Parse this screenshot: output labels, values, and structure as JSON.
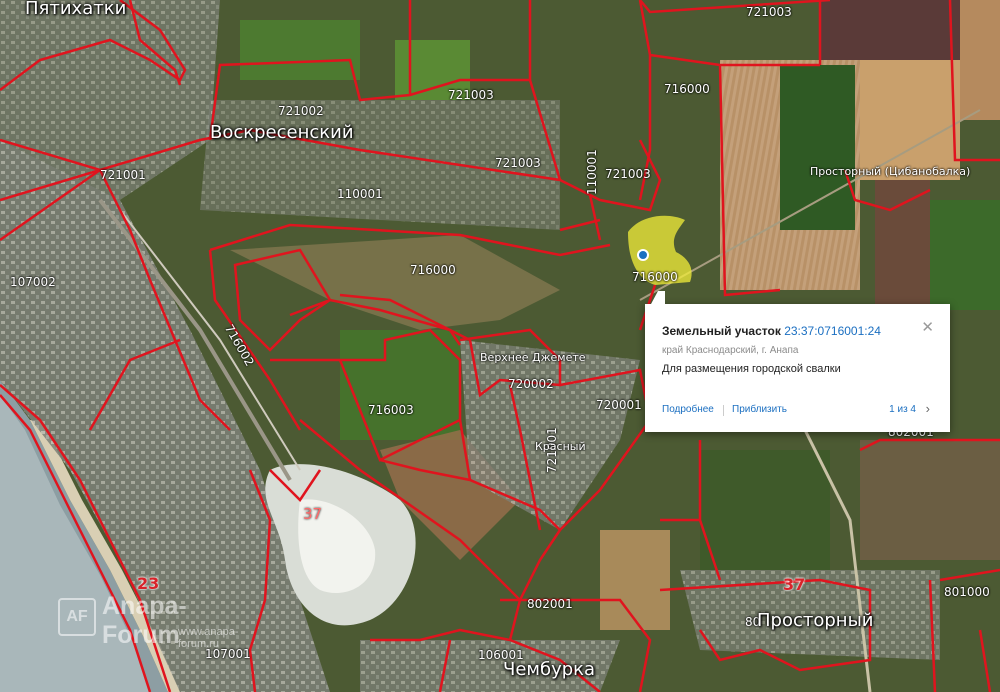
{
  "map": {
    "towns": {
      "pyatikhatki": "Пятихатки",
      "voskresensky": "Воскресенский",
      "prostorny": "Просторный",
      "chemburka": "Чембурка"
    },
    "small_places": {
      "verkhnee_dzhemete": "Верхнее Джемете",
      "krasny": "Красный",
      "prostorny_tsibanobalka": "Просторный (Цибанобалка)"
    },
    "parcels": {
      "p721003_top": "721003",
      "p721002": "721002",
      "p721003_a": "721003",
      "p721003_b": "721003",
      "p721003_c": "721003",
      "p716000_ne": "716000",
      "p721001": "721001",
      "p110001": "110001",
      "p110001_vert": "110001",
      "p716000_mid": "716000",
      "p716000_yellow": "716000",
      "p107002": "107002",
      "p716002": "716002",
      "p716003": "716003",
      "p720002": "720002",
      "p720001": "720001",
      "p721001_vert": "721001",
      "p802001": "802001",
      "p801000": "801000",
      "p106001": "106001",
      "p107001": "107001",
      "p80x": "80",
      "p802001_partial": "802001"
    },
    "road_numbers": {
      "r23": "23",
      "r37": "37"
    },
    "zones": {
      "z37": "37"
    },
    "watermark": {
      "logo": "AF",
      "title": "Anapa-Forum",
      "url": "www.anapa-forum.ru"
    },
    "colors": {
      "boundary": "#e0141e",
      "highlight": "#f3ef3a",
      "link": "#1b6fc1"
    }
  },
  "popup": {
    "title_prefix": "Земельный участок",
    "cadastral_number": "23:37:0716001:24",
    "address": "край Краснодарский, г. Анапа",
    "purpose": "Для размещения городской свалки",
    "more_label": "Подробнее",
    "zoom_label": "Приблизить",
    "pager": "1 из 4",
    "next_icon": "chevron-right",
    "close_icon": "close"
  }
}
